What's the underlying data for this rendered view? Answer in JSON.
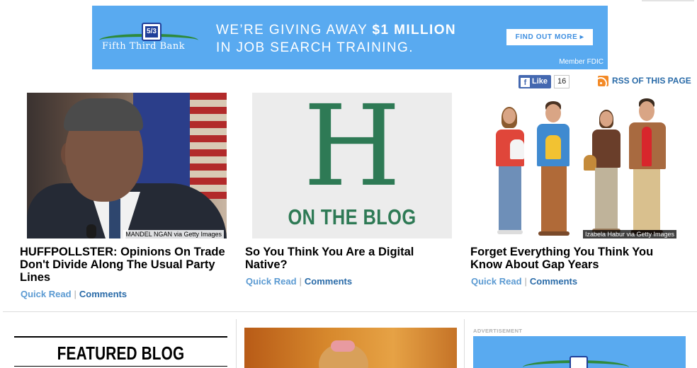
{
  "top_ad": {
    "bank_name": "Fifth Third Bank",
    "logo_mark": "5/3",
    "headline_pre": "WE’RE GIVING AWAY ",
    "headline_bold": "$1 MILLION",
    "headline_line2": "IN JOB SEARCH TRAINING.",
    "cta": "FIND OUT MORE ▸",
    "fdic": "Member FDIC",
    "bg_color": "#59aaf0"
  },
  "social": {
    "like_label": "Like",
    "like_icon": "f",
    "like_count": "16",
    "rss_label": "RSS OF THIS PAGE"
  },
  "stories": [
    {
      "title": "HUFFPOLLSTER: Opinions On Trade Don't Divide Along The Usual Party Lines",
      "photo_credit": "MANDEL NGAN via Getty Images",
      "quick_read": "Quick Read",
      "separator": "|",
      "comments": "Comments"
    },
    {
      "title": "So You Think You Are a Digital Native?",
      "logo_letter": "H",
      "logo_caption": "ON THE BLOG",
      "quick_read": "Quick Read",
      "separator": "|",
      "comments": "Comments"
    },
    {
      "title": "Forget Everything You Think You Know About Gap Years",
      "photo_credit": "Izabela Habur via Getty Images",
      "quick_read": "Quick Read",
      "separator": "|",
      "comments": "Comments"
    }
  ],
  "featured": {
    "heading": "FEATURED BLOG POSTS"
  },
  "sidebar_ad": {
    "label": "ADVERTISEMENT"
  },
  "colors": {
    "link_blue": "#2a6ba8",
    "quick_read_blue": "#5b9ad2",
    "blog_green": "#2e7a55",
    "rss_orange": "#f38a27",
    "facebook_blue": "#4468b0"
  }
}
